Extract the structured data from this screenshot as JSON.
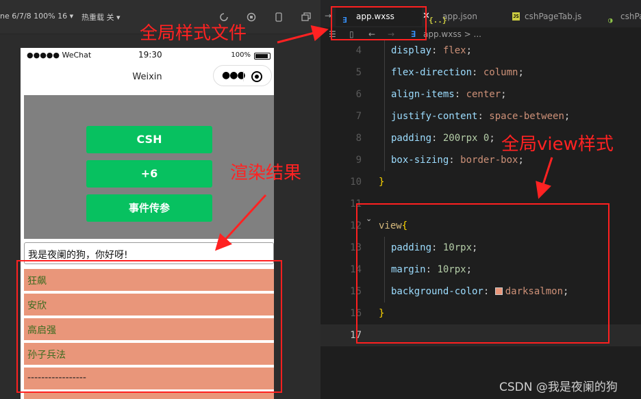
{
  "simulator": {
    "device_label": "ne 6/7/8 100% 16 ▾",
    "hot_reload_label": "热重载 关 ▾",
    "status": {
      "carrier": "●●●●● WeChat",
      "time": "19:30",
      "battery": "100%"
    },
    "nav_title": "Weixin",
    "buttons": [
      "CSH",
      "+6",
      "事件传参"
    ],
    "input_value": "我是夜阑的狗，你好呀!",
    "list_items": [
      "狂飙",
      "安欣",
      "高启强",
      "孙子兵法",
      "-----------------",
      ""
    ]
  },
  "editor": {
    "tabs": [
      {
        "icon": "wxss-icon",
        "label": "app.wxss",
        "active": true
      },
      {
        "icon": "json-icon",
        "label": "app.json",
        "active": false
      },
      {
        "icon": "js-icon",
        "label": "cshPageTab.js",
        "active": false
      },
      {
        "icon": "page-icon",
        "label": "cshPa",
        "active": false
      }
    ],
    "tab_icon_glyphs": {
      "wxss": "∃",
      "json": "{..}",
      "js": "JS",
      "page": "◑"
    },
    "close_glyph": "✕",
    "breadcrumb": "app.wxss > ...",
    "code_lines": [
      {
        "n": "4",
        "indent": 1,
        "prop": "display",
        "value": "flex"
      },
      {
        "n": "5",
        "indent": 1,
        "prop": "flex-direction",
        "value": "column"
      },
      {
        "n": "6",
        "indent": 1,
        "prop": "align-items",
        "value": "center"
      },
      {
        "n": "7",
        "indent": 1,
        "prop": "justify-content",
        "value": "space-between"
      },
      {
        "n": "8",
        "indent": 1,
        "prop": "padding",
        "value": "200rpx 0"
      },
      {
        "n": "9",
        "indent": 1,
        "prop": "box-sizing",
        "value": "border-box"
      },
      {
        "n": "10",
        "indent": 0,
        "text": "}"
      },
      {
        "n": "11",
        "indent": 0,
        "text": ""
      },
      {
        "n": "12",
        "indent": 0,
        "selector": "view"
      },
      {
        "n": "13",
        "indent": 1,
        "prop": "padding",
        "value": "10rpx"
      },
      {
        "n": "14",
        "indent": 1,
        "prop": "margin",
        "value": "10rpx"
      },
      {
        "n": "15",
        "indent": 1,
        "prop": "background-color",
        "value": "darksalmon",
        "swatch": "#e9967a"
      },
      {
        "n": "16",
        "indent": 0,
        "text": "}"
      },
      {
        "n": "17",
        "indent": 0,
        "text": "",
        "current": true
      }
    ]
  },
  "annotations": {
    "global_style_file": "全局样式文件",
    "render_result": "渲染结果",
    "global_view_style": "全局view样式",
    "color": "#ff2222"
  },
  "watermark": "CSDN @我是夜阑的狗"
}
